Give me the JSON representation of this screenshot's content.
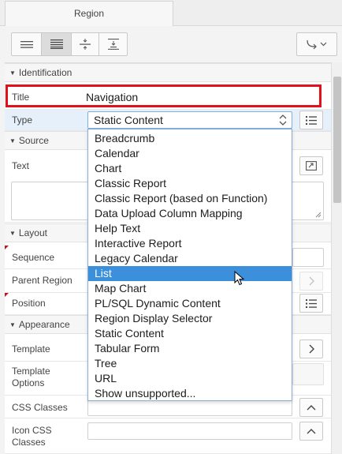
{
  "tab": {
    "label": "Region"
  },
  "toolbar": {
    "buttons": [
      "list-compact-icon",
      "list-expanded-icon",
      "collapse-icon",
      "expand-icon",
      "go-to-group-icon"
    ]
  },
  "sections": {
    "identification": "Identification",
    "source": "Source",
    "layout": "Layout",
    "appearance": "Appearance"
  },
  "fields": {
    "title_label": "Title",
    "title_value": "Navigation",
    "type_label": "Type",
    "type_value": "Static Content",
    "text_label": "Text",
    "sequence_label": "Sequence",
    "parent_region_label": "Parent Region",
    "position_label": "Position",
    "template_label": "Template",
    "template_options_label": "Template Options",
    "css_classes_label": "CSS Classes",
    "icon_css_classes_label": "Icon CSS Classes"
  },
  "dropdown": {
    "options": [
      "Breadcrumb",
      "Calendar",
      "Chart",
      "Classic Report",
      "Classic Report (based on Function)",
      "Data Upload Column Mapping",
      "Help Text",
      "Interactive Report",
      "Legacy Calendar",
      "List",
      "Map Chart",
      "PL/SQL Dynamic Content",
      "Region Display Selector",
      "Static Content",
      "Tabular Form",
      "Tree",
      "URL",
      "Show unsupported..."
    ],
    "selected": "List"
  },
  "colors": {
    "highlight": "#3b8fdb",
    "required_outline": "#e0111b",
    "required_marker": "#c0161b"
  }
}
